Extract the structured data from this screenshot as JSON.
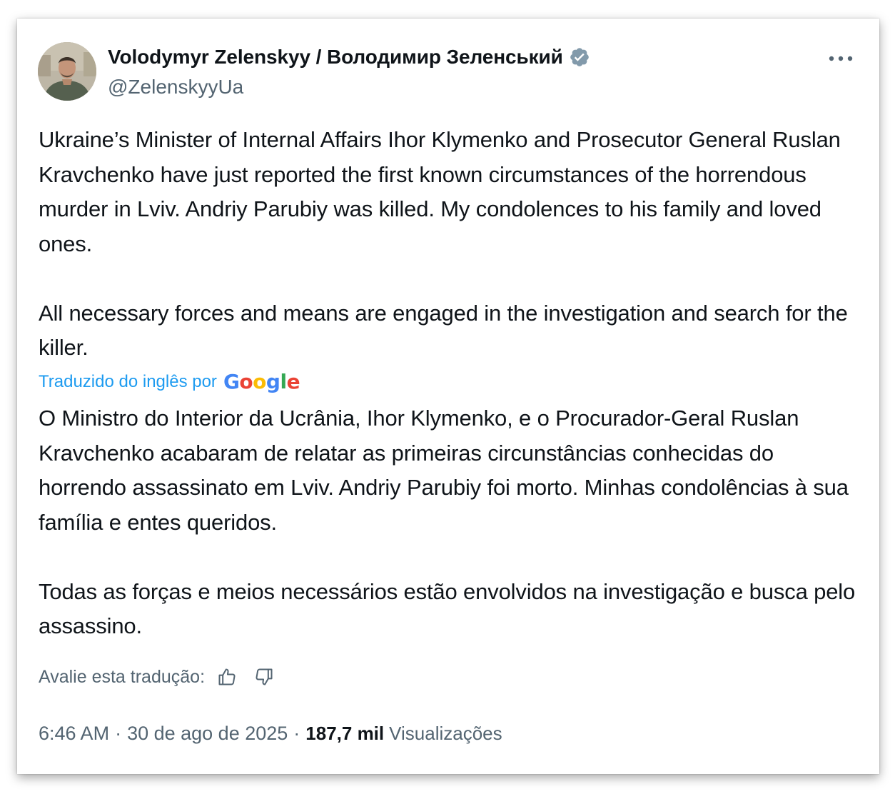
{
  "author": {
    "display_name": "Volodymyr Zelenskyy / Володимир Зеленський",
    "handle": "@ZelenskyyUa",
    "avatar_icon": "avatar-photo",
    "verified_icon": "verified-badge-icon"
  },
  "more_icon": "more-options-icon",
  "original_text": [
    "Ukraine’s Minister of Internal Affairs Ihor Klymenko and Prosecutor General Ruslan Kravchenko have just reported the first known circumstances of the horrendous murder in Lviv. Andriy Parubiy was killed. My condolences to his family and loved ones.",
    "All necessary forces and means are engaged in the investigation and search for the killer."
  ],
  "translation": {
    "label": "Traduzido do inglês por",
    "provider": "Google",
    "text": [
      "O Ministro do Interior da Ucrânia, Ihor Klymenko, e o Procurador-Geral Ruslan Kravchenko acabaram de relatar as primeiras circunstâncias conhecidas do horrendo assassinato em Lviv. Andriy Parubiy foi morto. Minhas condolências à sua família e entes queridos.",
      "Todas as forças e meios necessários estão envolvidos na investigação e busca pelo assassino."
    ],
    "rate_label": "Avalie esta tradução:",
    "thumbs_up_icon": "thumbs-up-icon",
    "thumbs_down_icon": "thumbs-down-icon"
  },
  "meta": {
    "time": "6:46 AM",
    "separator": "·",
    "date": "30 de ago de 2025",
    "views_count": "187,7 mil",
    "views_label": "Visualizações"
  },
  "colors": {
    "text_primary": "#0f1419",
    "text_secondary": "#536471",
    "accent_blue": "#1d9bf0",
    "verified_badge": "#829aab"
  }
}
